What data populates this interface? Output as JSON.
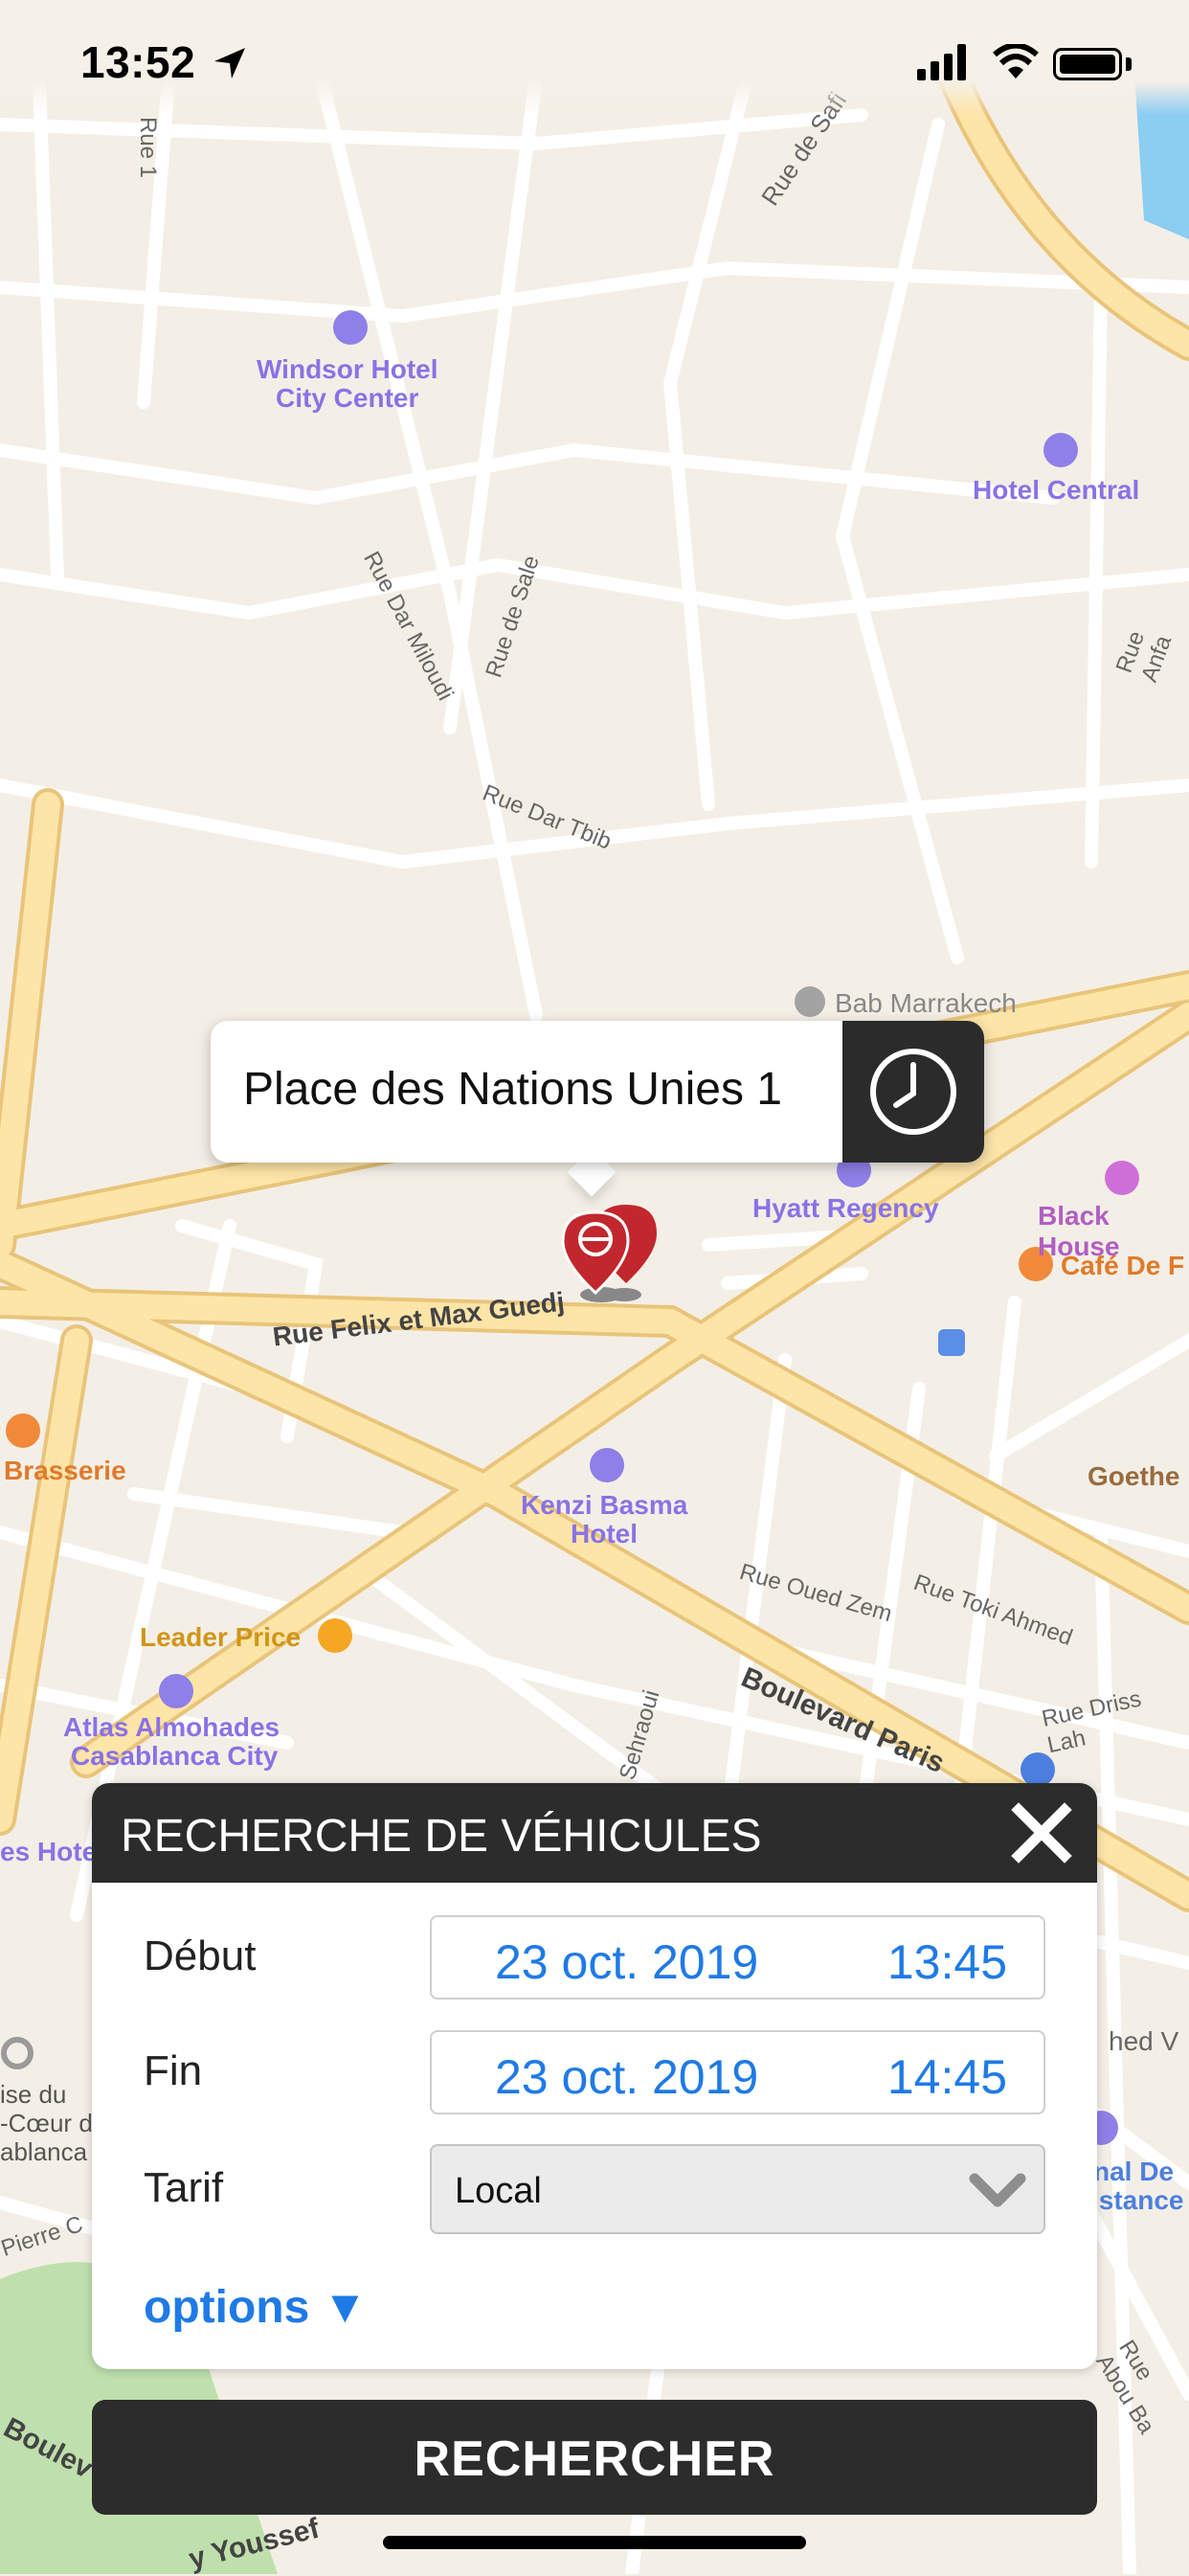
{
  "status_bar": {
    "time": "13:52"
  },
  "map": {
    "labels": {
      "rue_1": "Rue 1",
      "rue_de_safi": "Rue de Safi",
      "windsor_1": "Windsor Hotel",
      "windsor_2": "City Center",
      "hotel_central": "Hotel Central",
      "rue_anfa": "Rue Anfa",
      "rue_dar_miloudi": "Rue Dar Miloudi",
      "rue_de_sale": "Rue de Sale",
      "rue_dar_tbib": "Rue Dar Tbib",
      "bab_marrakech": "Bab Marrakech",
      "hyatt": "Hyatt Regency",
      "black_house": "Black House",
      "cafe_de_france": "Café De F",
      "rue_felix": "Rue Felix et Max Guedj",
      "brasserie": "Brasserie",
      "goethe": "Goethe",
      "kenzi_1": "Kenzi Basma",
      "kenzi_2": "Hotel",
      "rue_oued_zem": "Rue Oued Zem",
      "rue_toki_ahmed": "Rue Toki Ahmed",
      "leader_price": "Leader Price",
      "boulevard_paris": "Boulevard Paris",
      "rue_driss_lah": "Rue Driss Lah",
      "atlas_1": "Atlas Almohades",
      "atlas_2": "Casablanca City",
      "es_hote": "es Hote",
      "sehraoui": "mane Sehraoui",
      "sacre_1": "ise du",
      "sacre_2": "-Cœur de",
      "sacre_3": "ablanca",
      "pierre": "Pierre C",
      "ed_v": "hed V",
      "nal_de_1": "nal De",
      "nal_de_2": "istance",
      "abou_bakr": "Rue Abou Ba",
      "youssef": "y Youssef",
      "boulevard_left": "Boulev"
    }
  },
  "callout": {
    "title": "Place des Nations Unies 1"
  },
  "search_panel": {
    "title": "RECHERCHE DE VÉHICULES",
    "start": {
      "label": "Début",
      "date": "23 oct. 2019",
      "time": "13:45"
    },
    "end": {
      "label": "Fin",
      "date": "23 oct. 2019",
      "time": "14:45"
    },
    "tarif": {
      "label": "Tarif",
      "value": "Local"
    },
    "options_label": "options ▼"
  },
  "search_button": {
    "label": "RECHERCHER"
  },
  "colors": {
    "accent_blue": "#1f7ae6",
    "panel_dark": "#2c2c2c",
    "pin_red": "#c1272d",
    "road_yellow": "#fbd98a"
  }
}
